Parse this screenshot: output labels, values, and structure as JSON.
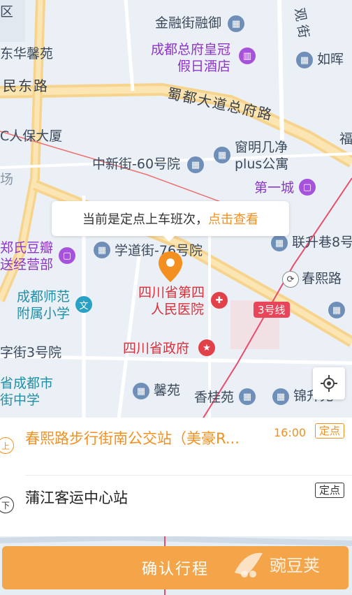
{
  "map": {
    "pois": [
      {
        "id": "jinrong",
        "label": "金融街融御",
        "style": "dark"
      },
      {
        "id": "donghua",
        "label": "东华馨苑",
        "style": "dark"
      },
      {
        "id": "crowne1",
        "label": "成都总府皇冠",
        "style": "purple"
      },
      {
        "id": "crowne2",
        "label": "假日酒店",
        "style": "purple"
      },
      {
        "id": "ruhui",
        "label": "如晖",
        "style": "dark"
      },
      {
        "id": "minzhong",
        "label": "民东路",
        "style": "road"
      },
      {
        "id": "shudu",
        "label": "蜀都大道总府路",
        "style": "road"
      },
      {
        "id": "renbao",
        "label": "C人保大厦",
        "style": "dark"
      },
      {
        "id": "zhongxin",
        "label": "中新街-60号院",
        "style": "dark"
      },
      {
        "id": "chuangming1",
        "label": "窗明几净",
        "style": "dark"
      },
      {
        "id": "chuangming2",
        "label": "plus公寓",
        "style": "dark"
      },
      {
        "id": "chang",
        "label": "场",
        "style": "dark"
      },
      {
        "id": "diyicheng",
        "label": "第一城",
        "style": "purple"
      },
      {
        "id": "zhengshi1",
        "label": "郑氏豆瓣",
        "style": "purple"
      },
      {
        "id": "zhengshi2",
        "label": "送经营部",
        "style": "purple"
      },
      {
        "id": "xuedao",
        "label": "学道街-76号院",
        "style": "dark"
      },
      {
        "id": "liansheng",
        "label": "联升巷8号",
        "style": "dark"
      },
      {
        "id": "chunxi",
        "label": "春熙路",
        "style": "dark"
      },
      {
        "id": "shifan1",
        "label": "成都师范",
        "style": "teal"
      },
      {
        "id": "shifan2",
        "label": "附属小学",
        "style": "teal"
      },
      {
        "id": "disi1",
        "label": "四川省第四",
        "style": "red"
      },
      {
        "id": "disi2",
        "label": "人民医院",
        "style": "red"
      },
      {
        "id": "shengzhengfu",
        "label": "四川省政府",
        "style": "red"
      },
      {
        "id": "zijie",
        "label": "字街3号院",
        "style": "dark"
      },
      {
        "id": "chengdushi1",
        "label": "省成都市",
        "style": "teal"
      },
      {
        "id": "chengdushi2",
        "label": "街中学",
        "style": "teal"
      },
      {
        "id": "xinyuan",
        "label": "馨苑",
        "style": "dark"
      },
      {
        "id": "xianggui",
        "label": "香桂苑",
        "style": "dark"
      },
      {
        "id": "jinjiang",
        "label": "锦升苑",
        "style": "dark"
      },
      {
        "id": "fu",
        "label": "福",
        "style": "dark"
      },
      {
        "id": "guan",
        "label": "观",
        "style": "dark"
      },
      {
        "id": "jie",
        "label": "街",
        "style": "dark"
      },
      {
        "id": "qu",
        "label": "区",
        "style": "dark"
      }
    ],
    "metro_line": "3号线",
    "tooltip": {
      "text": "当前是定点上车班次，",
      "link": "点击查看"
    }
  },
  "stops": {
    "up": {
      "marker": "上",
      "name": "春熙路步行街南公交站（美豪R...",
      "time": "16:00",
      "tag": "定点"
    },
    "down": {
      "marker": "下",
      "name": "蒲江客运中心站",
      "tag": "定点"
    }
  },
  "confirm_button": "确认行程",
  "watermark": "豌豆荚",
  "colors": {
    "accent": "#f3901f",
    "button": "#f4a54a"
  }
}
